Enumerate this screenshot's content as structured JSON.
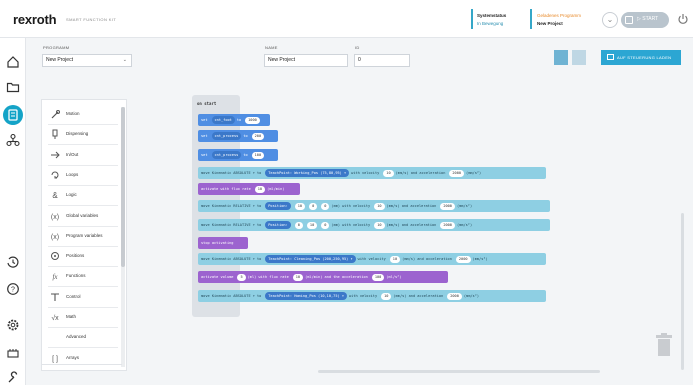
{
  "header": {
    "logo": "rexroth",
    "logo_sub": "SMART FUNCTION KIT",
    "system_status_label": "Systemstatus",
    "system_status_value": "In Bewegung",
    "loaded_program_label": "Geladenes Programm",
    "loaded_program_value": "New Project",
    "start_label": "START"
  },
  "form": {
    "program_label": "PROGRAMM",
    "program_value": "New Project",
    "name_label": "NAME",
    "name_value": "New Project",
    "id_label": "ID",
    "id_value": "0",
    "upload_label": "AUF STEUERUNG LADEN"
  },
  "palette": {
    "items": [
      {
        "label": "Motion",
        "icon": "motion-icon"
      },
      {
        "label": "Dispensing",
        "icon": "dispensing-icon"
      },
      {
        "label": "In/Out",
        "icon": "in-out-icon"
      },
      {
        "label": "Loops",
        "icon": "loops-icon"
      },
      {
        "label": "Logic",
        "icon": "logic-icon"
      },
      {
        "label": "Global variables",
        "icon": "global-variables-icon"
      },
      {
        "label": "Program variables",
        "icon": "program-variables-icon"
      },
      {
        "label": "Positions",
        "icon": "positions-icon"
      },
      {
        "label": "Functions",
        "icon": "functions-icon"
      },
      {
        "label": "Control",
        "icon": "control-icon"
      },
      {
        "label": "Math",
        "icon": "math-icon"
      },
      {
        "label": "Advanced",
        "icon": ""
      },
      {
        "label": "Arrays",
        "icon": "arrays-icon"
      }
    ]
  },
  "workspace": {
    "hat_label": "on start",
    "blocks": [
      {
        "type": "var",
        "parts": [
          "set",
          {
            "pill": "cnt_foot"
          },
          "to",
          {
            "chip": "1000"
          }
        ]
      },
      {
        "type": "var",
        "parts": [
          "set",
          {
            "pill": "cnt_process"
          },
          "to",
          {
            "chip": "200"
          }
        ]
      },
      {
        "type": "var",
        "parts": [
          "set",
          {
            "pill": "cnt_process"
          },
          "to",
          {
            "chip": "100"
          }
        ]
      },
      {
        "type": "move",
        "parts": [
          "move Kinematic",
          "ABSOLUTE ▾",
          "to",
          {
            "pill": "TeachPoint: Working_Pos (75,80,95) ▾"
          },
          "with velocity",
          {
            "chip": "10"
          },
          "(mm/s) and acceleration",
          {
            "chip": "2000"
          },
          "(mm/s²)"
        ]
      },
      {
        "type": "act",
        "parts": [
          "activate with flux rate",
          {
            "chip": "10"
          },
          "(ml/min)"
        ]
      },
      {
        "type": "move",
        "parts": [
          "move Kinematic",
          "RELATIVE ▾",
          "to",
          {
            "pill": "Position:"
          },
          {
            "chip": "10"
          },
          {
            "chip": "0"
          },
          {
            "chip": "0"
          },
          "(mm)",
          "with velocity",
          {
            "chip": "10"
          },
          "(mm/s) and acceleration",
          {
            "chip": "2000"
          },
          "(mm/s²)"
        ]
      },
      {
        "type": "move",
        "parts": [
          "move Kinematic",
          "RELATIVE ▾",
          "to",
          {
            "pill": "Position:"
          },
          {
            "chip": "0"
          },
          {
            "chip": "10"
          },
          {
            "chip": "0"
          },
          "(mm)",
          "with velocity",
          {
            "chip": "10"
          },
          "(mm/s) and acceleration",
          {
            "chip": "2000"
          },
          "(mm/s²)"
        ]
      },
      {
        "type": "act",
        "parts": [
          "stop activating"
        ]
      },
      {
        "type": "move",
        "parts": [
          "move Kinematic",
          "ABSOLUTE ▾",
          "to",
          {
            "pill": "TeachPoint: Cleaning_Pos (200,250,95) ▾"
          },
          "with velocity",
          {
            "chip": "10"
          },
          "(mm/s) and acceleration",
          {
            "chip": "2000"
          },
          "(mm/s²)"
        ]
      },
      {
        "type": "act",
        "parts": [
          "activate volume",
          {
            "chip": "5"
          },
          "(ml) with flux rate",
          {
            "chip": "10"
          },
          "(ml/min) and the acceleration",
          {
            "chip": "100"
          },
          "(ml/s²)"
        ]
      },
      {
        "type": "move",
        "parts": [
          "move Kinematic",
          "ABSOLUTE ▾",
          "to",
          {
            "pill": "TeachPoint: Homing_Pos (10,10,75) ▾"
          },
          "with velocity",
          {
            "chip": "10"
          },
          "(mm/s) and acceleration",
          {
            "chip": "2000"
          },
          "(mm/s²)"
        ]
      }
    ]
  },
  "colors": {
    "accent": "#14a3c7",
    "variable_block": "#4f8ee3",
    "motion_block": "#8ecfe3",
    "dispense_block": "#9c63cf"
  }
}
